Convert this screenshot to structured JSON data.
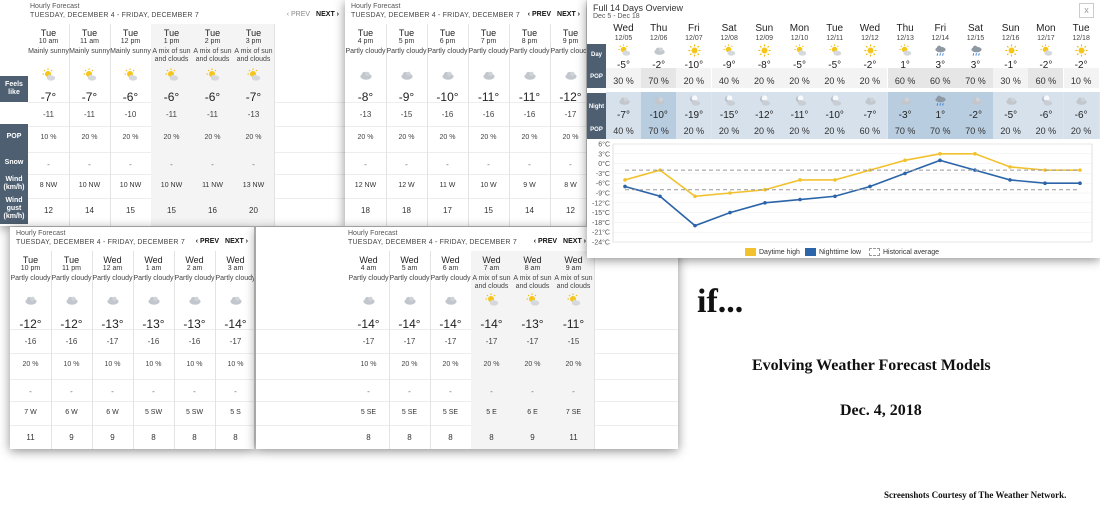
{
  "hourly_header": {
    "title": "Hourly Forecast",
    "subtitle": "TUESDAY, DECEMBER 4 - FRIDAY, DECEMBER 7",
    "prev_label": "‹ PREV",
    "next_label": "NEXT ›",
    "prev_label_plain": "PREV",
    "next_label_plain": "NEXT ›"
  },
  "row_labels": {
    "feels_like": "Feels like",
    "pop": "POP",
    "snow": "Snow",
    "wind": "Wind (km/h)",
    "wind_gust": "Wind gust (km/h)"
  },
  "panel1": [
    {
      "day": "Tue",
      "time": "10 am",
      "cond": "Mainly sunny",
      "icon": "sun-cloud-icon",
      "temp": "-7°",
      "feels": "-11",
      "pop": "10 %",
      "snow": "-",
      "wind": "8 NW",
      "gust": "12"
    },
    {
      "day": "Tue",
      "time": "11 am",
      "cond": "Mainly sunny",
      "icon": "sun-cloud-icon",
      "temp": "-7°",
      "feels": "-11",
      "pop": "20 %",
      "snow": "-",
      "wind": "10 NW",
      "gust": "14"
    },
    {
      "day": "Tue",
      "time": "12 pm",
      "cond": "Mainly sunny",
      "icon": "sun-cloud-icon",
      "temp": "-6°",
      "feels": "-10",
      "pop": "20 %",
      "snow": "-",
      "wind": "10 NW",
      "gust": "15"
    },
    {
      "day": "Tue",
      "time": "1 pm",
      "cond": "A mix of sun and clouds",
      "icon": "sun-cloud-icon",
      "temp": "-6°",
      "feels": "-11",
      "pop": "20 %",
      "snow": "-",
      "wind": "10 NW",
      "gust": "15"
    },
    {
      "day": "Tue",
      "time": "2 pm",
      "cond": "A mix of sun and clouds",
      "icon": "sun-cloud-icon",
      "temp": "-6°",
      "feels": "-11",
      "pop": "20 %",
      "snow": "-",
      "wind": "11 NW",
      "gust": "16"
    },
    {
      "day": "Tue",
      "time": "3 pm",
      "cond": "A mix of sun and clouds",
      "icon": "sun-cloud-icon",
      "temp": "-7°",
      "feels": "-13",
      "pop": "20 %",
      "snow": "-",
      "wind": "13 NW",
      "gust": "20"
    }
  ],
  "panel2": [
    {
      "day": "Tue",
      "time": "4 pm",
      "cond": "Partly cloudy",
      "icon": "cloud-icon",
      "temp": "-8°",
      "feels": "-13",
      "pop": "20 %",
      "snow": "-",
      "wind": "12 NW",
      "gust": "18"
    },
    {
      "day": "Tue",
      "time": "5 pm",
      "cond": "Partly cloudy",
      "icon": "cloud-icon",
      "temp": "-9°",
      "feels": "-15",
      "pop": "20 %",
      "snow": "-",
      "wind": "12 W",
      "gust": "18"
    },
    {
      "day": "Tue",
      "time": "6 pm",
      "cond": "Partly cloudy",
      "icon": "cloud-icon",
      "temp": "-10°",
      "feels": "-16",
      "pop": "20 %",
      "snow": "-",
      "wind": "11 W",
      "gust": "17"
    },
    {
      "day": "Tue",
      "time": "7 pm",
      "cond": "Partly cloudy",
      "icon": "cloud-icon",
      "temp": "-11°",
      "feels": "-16",
      "pop": "20 %",
      "snow": "-",
      "wind": "10 W",
      "gust": "15"
    },
    {
      "day": "Tue",
      "time": "8 pm",
      "cond": "Partly cloudy",
      "icon": "cloud-icon",
      "temp": "-11°",
      "feels": "-16",
      "pop": "20 %",
      "snow": "-",
      "wind": "9 W",
      "gust": "14"
    },
    {
      "day": "Tue",
      "time": "9 pm",
      "cond": "Partly cloudy",
      "icon": "cloud-icon",
      "temp": "-12°",
      "feels": "-17",
      "pop": "20 %",
      "snow": "-",
      "wind": "8 W",
      "gust": "12"
    }
  ],
  "panel3": [
    {
      "day": "Tue",
      "time": "10 pm",
      "cond": "Partly cloudy",
      "icon": "cloud-icon",
      "temp": "-12°",
      "feels": "-16",
      "pop": "20 %",
      "snow": "-",
      "wind": "7 W",
      "gust": "11"
    },
    {
      "day": "Tue",
      "time": "11 pm",
      "cond": "Partly cloudy",
      "icon": "cloud-icon",
      "temp": "-12°",
      "feels": "-16",
      "pop": "10 %",
      "snow": "-",
      "wind": "6 W",
      "gust": "9"
    },
    {
      "day": "Wed",
      "time": "12 am",
      "cond": "Partly cloudy",
      "icon": "cloud-icon",
      "temp": "-13°",
      "feels": "-17",
      "pop": "10 %",
      "snow": "-",
      "wind": "6 W",
      "gust": "9"
    },
    {
      "day": "Wed",
      "time": "1 am",
      "cond": "Partly cloudy",
      "icon": "cloud-icon",
      "temp": "-13°",
      "feels": "-16",
      "pop": "10 %",
      "snow": "-",
      "wind": "5 SW",
      "gust": "8"
    },
    {
      "day": "Wed",
      "time": "2 am",
      "cond": "Partly cloudy",
      "icon": "cloud-icon",
      "temp": "-13°",
      "feels": "-16",
      "pop": "10 %",
      "snow": "-",
      "wind": "5 SW",
      "gust": "8"
    },
    {
      "day": "Wed",
      "time": "3 am",
      "cond": "Partly cloudy",
      "icon": "cloud-icon",
      "temp": "-14°",
      "feels": "-17",
      "pop": "10 %",
      "snow": "-",
      "wind": "5 S",
      "gust": "8"
    }
  ],
  "panel4": [
    {
      "day": "Wed",
      "time": "4 am",
      "cond": "Partly cloudy",
      "icon": "cloud-icon",
      "temp": "-14°",
      "feels": "-17",
      "pop": "10 %",
      "snow": "-",
      "wind": "5 SE",
      "gust": "8"
    },
    {
      "day": "Wed",
      "time": "5 am",
      "cond": "Partly cloudy",
      "icon": "cloud-icon",
      "temp": "-14°",
      "feels": "-17",
      "pop": "20 %",
      "snow": "-",
      "wind": "5 SE",
      "gust": "8"
    },
    {
      "day": "Wed",
      "time": "6 am",
      "cond": "Partly cloudy",
      "icon": "cloud-icon",
      "temp": "-14°",
      "feels": "-17",
      "pop": "20 %",
      "snow": "-",
      "wind": "5 SE",
      "gust": "8"
    },
    {
      "day": "Wed",
      "time": "7 am",
      "cond": "A mix of sun and clouds",
      "icon": "sun-cloud-icon",
      "temp": "-14°",
      "feels": "-17",
      "pop": "20 %",
      "snow": "-",
      "wind": "5 E",
      "gust": "8"
    },
    {
      "day": "Wed",
      "time": "8 am",
      "cond": "A mix of sun and clouds",
      "icon": "sun-cloud-icon",
      "temp": "-13°",
      "feels": "-17",
      "pop": "20 %",
      "snow": "-",
      "wind": "6 E",
      "gust": "9"
    },
    {
      "day": "Wed",
      "time": "9 am",
      "cond": "A mix of sun and clouds",
      "icon": "sun-cloud-icon",
      "temp": "-11°",
      "feels": "-15",
      "pop": "20 %",
      "snow": "-",
      "wind": "7 SE",
      "gust": "11"
    }
  ],
  "overview": {
    "title": "Full 14 Days Overview",
    "subtitle": "Dec 5 - Dec 18",
    "close": "x",
    "day_label": "Day",
    "pop_label": "POP",
    "night_label": "Night",
    "days": [
      {
        "dn": "Wed",
        "dt": "12/05",
        "dicon": "sun-cloud-icon",
        "dtemp": "-5°",
        "dpop": "30 %",
        "nicon": "cloud-icon",
        "ntemp": "-7°",
        "npop": "40 %"
      },
      {
        "dn": "Thu",
        "dt": "12/06",
        "dicon": "cloud-icon",
        "dtemp": "-2°",
        "dpop": "70 %",
        "nicon": "cloud-icon",
        "ntemp": "-10°",
        "npop": "70 %"
      },
      {
        "dn": "Fri",
        "dt": "12/07",
        "dicon": "sun-icon",
        "dtemp": "-10°",
        "dpop": "20 %",
        "nicon": "moon-cloud-icon",
        "ntemp": "-19°",
        "npop": "20 %"
      },
      {
        "dn": "Sat",
        "dt": "12/08",
        "dicon": "sun-cloud-icon",
        "dtemp": "-9°",
        "dpop": "40 %",
        "nicon": "moon-cloud-icon",
        "ntemp": "-15°",
        "npop": "20 %"
      },
      {
        "dn": "Sun",
        "dt": "12/09",
        "dicon": "sun-icon",
        "dtemp": "-8°",
        "dpop": "20 %",
        "nicon": "moon-cloud-icon",
        "ntemp": "-12°",
        "npop": "20 %"
      },
      {
        "dn": "Mon",
        "dt": "12/10",
        "dicon": "sun-cloud-icon",
        "dtemp": "-5°",
        "dpop": "20 %",
        "nicon": "moon-cloud-icon",
        "ntemp": "-11°",
        "npop": "20 %"
      },
      {
        "dn": "Tue",
        "dt": "12/11",
        "dicon": "sun-cloud-icon",
        "dtemp": "-5°",
        "dpop": "20 %",
        "nicon": "moon-cloud-icon",
        "ntemp": "-10°",
        "npop": "20 %"
      },
      {
        "dn": "Wed",
        "dt": "12/12",
        "dicon": "sun-icon",
        "dtemp": "-2°",
        "dpop": "20 %",
        "nicon": "cloud-icon",
        "ntemp": "-7°",
        "npop": "60 %"
      },
      {
        "dn": "Thu",
        "dt": "12/13",
        "dicon": "sun-cloud-icon",
        "dtemp": "1°",
        "dpop": "60 %",
        "nicon": "cloud-icon",
        "ntemp": "-3°",
        "npop": "70 %"
      },
      {
        "dn": "Fri",
        "dt": "12/14",
        "dicon": "rain-icon",
        "dtemp": "3°",
        "dpop": "60 %",
        "nicon": "rain-icon",
        "ntemp": "1°",
        "npop": "70 %"
      },
      {
        "dn": "Sat",
        "dt": "12/15",
        "dicon": "rain-icon",
        "dtemp": "3°",
        "dpop": "70 %",
        "nicon": "cloud-icon",
        "ntemp": "-2°",
        "npop": "70 %"
      },
      {
        "dn": "Sun",
        "dt": "12/16",
        "dicon": "sun-icon",
        "dtemp": "-1°",
        "dpop": "30 %",
        "nicon": "cloud-icon",
        "ntemp": "-5°",
        "npop": "20 %"
      },
      {
        "dn": "Mon",
        "dt": "12/17",
        "dicon": "sun-cloud-icon",
        "dtemp": "-2°",
        "dpop": "60 %",
        "nicon": "moon-cloud-icon",
        "ntemp": "-6°",
        "npop": "20 %"
      },
      {
        "dn": "Tue",
        "dt": "12/18",
        "dicon": "sun-icon",
        "dtemp": "-2°",
        "dpop": "10 %",
        "nicon": "cloud-icon",
        "ntemp": "-6°",
        "npop": "20 %"
      }
    ]
  },
  "chart_data": {
    "type": "line",
    "x": [
      "12/05",
      "12/06",
      "12/07",
      "12/08",
      "12/09",
      "12/10",
      "12/11",
      "12/12",
      "12/13",
      "12/14",
      "12/15",
      "12/16",
      "12/17",
      "12/18"
    ],
    "series": [
      {
        "name": "Daytime high",
        "color": "#f2c12e",
        "values": [
          -5,
          -2,
          -10,
          -9,
          -8,
          -5,
          -5,
          -2,
          1,
          3,
          3,
          -1,
          -2,
          -2
        ]
      },
      {
        "name": "Nighttime low",
        "color": "#2b64a8",
        "values": [
          -7,
          -10,
          -19,
          -15,
          -12,
          -11,
          -10,
          -7,
          -3,
          1,
          -2,
          -5,
          -6,
          -6
        ]
      },
      {
        "name": "Historical average",
        "color": "#999999",
        "values": [
          -2,
          -2,
          -2,
          -2,
          -2,
          -2,
          -2,
          -2,
          -2,
          -2,
          -2,
          -2,
          -2,
          -2
        ]
      },
      {
        "name": "Historical average",
        "color": "#999999",
        "values": [
          -8,
          -8,
          -8,
          -8,
          -8,
          -8,
          -8,
          -8,
          -8,
          -8,
          -8,
          -8,
          -8,
          -8
        ]
      }
    ],
    "yticks": [
      "6°C",
      "3°C",
      "0°C",
      "-3°C",
      "-6°C",
      "-9°C",
      "-12°C",
      "-15°C",
      "-18°C",
      "-21°C",
      "-24°C"
    ],
    "ylim": [
      -24,
      6
    ],
    "legend": [
      "Daytime high",
      "Nighttime low",
      "Historical average"
    ],
    "legend_position": "bottom"
  },
  "slide": {
    "if_text": "if...",
    "title": "Evolving Weather Forecast Models",
    "date": "Dec. 4, 2018",
    "credit": "Screenshots Courtesy of The Weather Network."
  }
}
